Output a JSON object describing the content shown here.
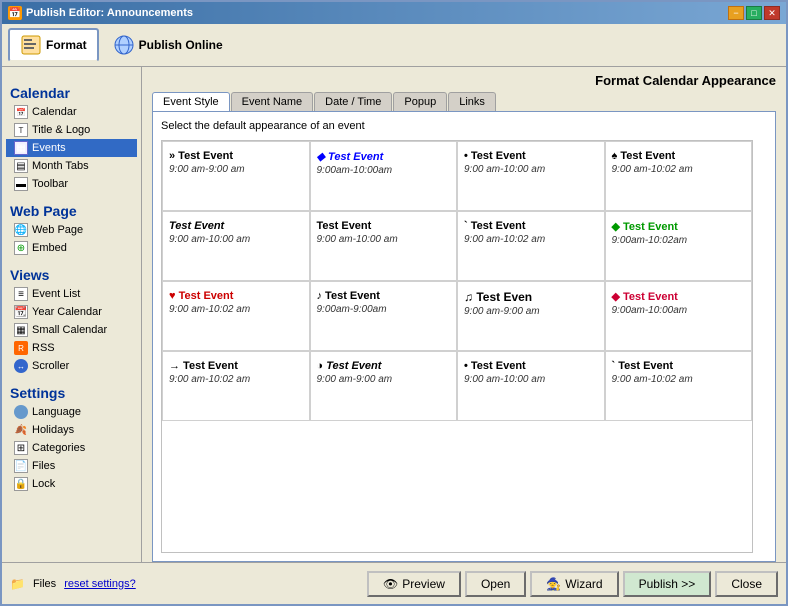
{
  "window": {
    "title": "Publish Editor: Announcements",
    "close_btn": "✕",
    "min_btn": "−",
    "max_btn": "□"
  },
  "toolbar": {
    "format_label": "Format",
    "publish_online_label": "Publish Online",
    "content_title": "Format Calendar Appearance"
  },
  "sidebar": {
    "calendar_section": "Calendar",
    "calendar_items": [
      {
        "id": "calendar",
        "label": "Calendar",
        "icon": "cal"
      },
      {
        "id": "title-logo",
        "label": "Title & Logo",
        "icon": "title"
      },
      {
        "id": "events",
        "label": "Events",
        "icon": "events",
        "selected": true
      },
      {
        "id": "month-tabs",
        "label": "Month Tabs",
        "icon": "months"
      },
      {
        "id": "toolbar",
        "label": "Toolbar",
        "icon": "toolbar"
      }
    ],
    "webpage_section": "Web Page",
    "webpage_items": [
      {
        "id": "web-page",
        "label": "Web Page",
        "icon": "webpage"
      },
      {
        "id": "embed",
        "label": "Embed",
        "icon": "embed"
      }
    ],
    "views_section": "Views",
    "views_items": [
      {
        "id": "event-list",
        "label": "Event List",
        "icon": "list"
      },
      {
        "id": "year-calendar",
        "label": "Year Calendar",
        "icon": "year"
      },
      {
        "id": "small-calendar",
        "label": "Small Calendar",
        "icon": "small"
      },
      {
        "id": "rss",
        "label": "RSS",
        "icon": "rss"
      },
      {
        "id": "scroller",
        "label": "Scroller",
        "icon": "scroller"
      }
    ],
    "settings_section": "Settings",
    "settings_items": [
      {
        "id": "language",
        "label": "Language",
        "icon": "language"
      },
      {
        "id": "holidays",
        "label": "Holidays",
        "icon": "holidays"
      },
      {
        "id": "categories",
        "label": "Categories",
        "icon": "categories"
      },
      {
        "id": "files",
        "label": "Files",
        "icon": "files"
      },
      {
        "id": "lock",
        "label": "Lock",
        "icon": "lock"
      }
    ]
  },
  "tabs": {
    "items": [
      {
        "id": "event-style",
        "label": "Event Style",
        "active": true
      },
      {
        "id": "event-name",
        "label": "Event Name"
      },
      {
        "id": "date-time",
        "label": "Date / Time"
      },
      {
        "id": "popup",
        "label": "Popup"
      },
      {
        "id": "links",
        "label": "Links"
      }
    ]
  },
  "content": {
    "description": "Select the default appearance of an event",
    "events": [
      {
        "name": "» Test Event",
        "time": "9:00 am-9:00 am",
        "color": "black",
        "bold": true,
        "italic": false
      },
      {
        "name": "◆ Test Event",
        "time": "9:00am-10:00am",
        "color": "blue",
        "bold": true,
        "italic": true
      },
      {
        "name": "• Test Event",
        "time": "9:00 am-10:00 am",
        "color": "black",
        "bold": false,
        "italic": false
      },
      {
        "name": "♠ Test Event",
        "time": "9:00 am-10:02 am",
        "color": "black",
        "bold": false,
        "italic": false
      },
      {
        "name": "Test Event",
        "time": "9:00 am-10:00 am",
        "color": "black",
        "bold": false,
        "italic": true
      },
      {
        "name": "Test Event",
        "time": "9:00 am-10:00 am",
        "color": "black",
        "bold": false,
        "italic": false
      },
      {
        "name": "` Test Event",
        "time": "9:00 am-10:02 am",
        "color": "black",
        "bold": false,
        "italic": false
      },
      {
        "name": "◆ Test Event",
        "time": "9:00am-10:02am",
        "color": "green",
        "bold": true,
        "italic": false
      },
      {
        "name": "♥ Test Event",
        "time": "9:00 am-10:02 am",
        "color": "red",
        "bold": true,
        "italic": false
      },
      {
        "name": "♪ Test Event",
        "time": "9:00am-9:00am",
        "color": "black",
        "bold": false,
        "italic": false
      },
      {
        "name": "♫ Test Even",
        "time": "9:00 am-9:00 am",
        "color": "black",
        "bold": true,
        "italic": false
      },
      {
        "name": "◆ Test Event",
        "time": "9:00am-10:00am",
        "color": "crimson",
        "bold": true,
        "italic": false
      },
      {
        "name": "→ Test Event",
        "time": "9:00 am-10:02 am",
        "color": "black",
        "bold": false,
        "italic": false
      },
      {
        "name": "◑ Test Event",
        "time": "9:00 am-9:00 am",
        "color": "black",
        "bold": false,
        "italic": true
      },
      {
        "name": "• Test Event",
        "time": "9:00 am-10:00 am",
        "color": "black",
        "bold": false,
        "italic": false
      },
      {
        "name": "` Test Event",
        "time": "9:00 am-10:02 am",
        "color": "black",
        "bold": false,
        "italic": false
      }
    ]
  },
  "footer": {
    "files_label": "Files",
    "reset_label": "reset settings?",
    "preview_label": "Preview",
    "open_label": "Open",
    "wizard_label": "Wizard",
    "publish_label": "Publish >>",
    "close_label": "Close"
  }
}
